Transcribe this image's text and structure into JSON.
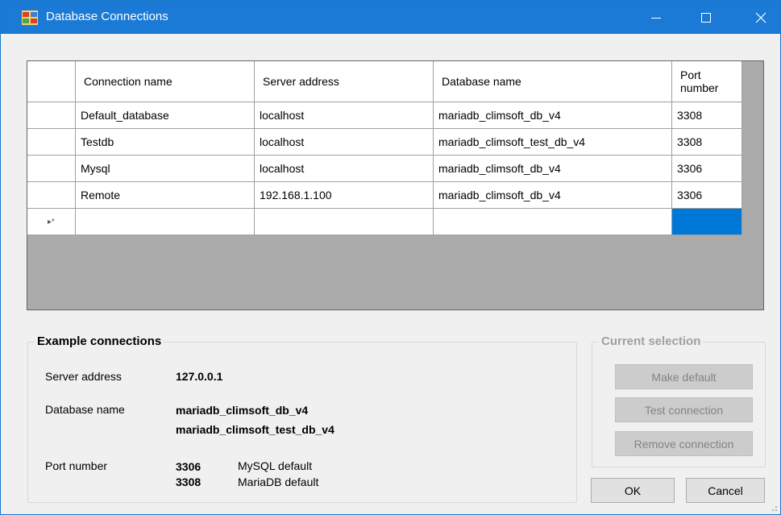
{
  "window": {
    "title": "Database Connections",
    "title_bar_color": "#1a7ad6",
    "icon": "database-app-icon"
  },
  "grid": {
    "columns": [
      "Connection name",
      "Server address",
      "Database name",
      "Port number"
    ],
    "port_header_line1": "Port",
    "port_header_line2": "number",
    "rows": [
      {
        "name": "Default_database",
        "server": "localhost",
        "database": "mariadb_climsoft_db_v4",
        "port": "3308"
      },
      {
        "name": "Testdb",
        "server": "localhost",
        "database": "mariadb_climsoft_test_db_v4",
        "port": "3308"
      },
      {
        "name": "Mysql",
        "server": "localhost",
        "database": "mariadb_climsoft_db_v4",
        "port": "3306"
      },
      {
        "name": "Remote",
        "server": "192.168.1.100",
        "database": "mariadb_climsoft_db_v4",
        "port": "3306"
      }
    ],
    "new_row_marker": "▸*",
    "selected_cell_color": "#0078d7"
  },
  "example": {
    "title": "Example connections",
    "server_label": "Server address",
    "server_value": "127.0.0.1",
    "db_label": "Database name",
    "db_value1": "mariadb_climsoft_db_v4",
    "db_value2": "mariadb_climsoft_test_db_v4",
    "port_label": "Port number",
    "port1": "3306",
    "port1_desc": "MySQL default",
    "port2": "3308",
    "port2_desc": "MariaDB default"
  },
  "current": {
    "title": "Current selection",
    "make_default": "Make default",
    "test_connection": "Test connection",
    "remove_connection": "Remove connection"
  },
  "footer": {
    "ok": "OK",
    "cancel": "Cancel"
  }
}
